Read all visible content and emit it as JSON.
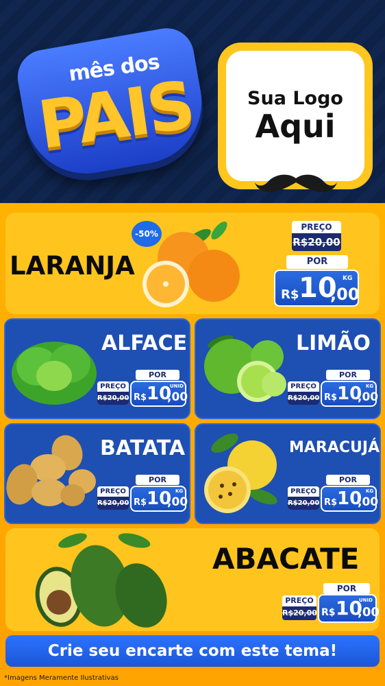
{
  "header": {
    "badge_sub": "mês dos",
    "badge_main": "PAIS",
    "logo_line1": "Sua Logo",
    "logo_line2": "Aqui"
  },
  "featured": {
    "name": "LARANJA",
    "discount": "-50%",
    "preco_label": "PREÇO",
    "old_price": "R$20,00",
    "por_label": "POR",
    "currency": "R$",
    "price_int": "10",
    "price_dec": ",00",
    "unit": "KG"
  },
  "products": [
    {
      "name": "ALFACE",
      "preco_label": "PREÇO",
      "old_price": "R$20,00",
      "por_label": "POR",
      "currency": "R$",
      "price_int": "10",
      "price_dec": ",00",
      "unit": "UNID"
    },
    {
      "name": "LIMÃO",
      "preco_label": "PREÇO",
      "old_price": "R$20,00",
      "por_label": "POR",
      "currency": "R$",
      "price_int": "10",
      "price_dec": ",00",
      "unit": "KG"
    },
    {
      "name": "BATATA",
      "preco_label": "PREÇO",
      "old_price": "R$20,00",
      "por_label": "POR",
      "currency": "R$",
      "price_int": "10",
      "price_dec": ",00",
      "unit": "KG"
    },
    {
      "name": "MARACUJÁ",
      "preco_label": "PREÇO",
      "old_price": "R$20,00",
      "por_label": "POR",
      "currency": "R$",
      "price_int": "10",
      "price_dec": ",00",
      "unit": "KG"
    }
  ],
  "bottom": {
    "name": "ABACATE",
    "preco_label": "PREÇO",
    "old_price": "R$20,00",
    "por_label": "POR",
    "currency": "R$",
    "price_int": "10",
    "price_dec": ",00",
    "unit": "UNID"
  },
  "cta": "Crie seu encarte com este tema!",
  "disclaimer": "*Imagens Meramente Ilustrativas",
  "colors": {
    "navy": "#0e2146",
    "yellow": "#ffc51e",
    "orange": "#ffa000",
    "blue": "#1e4fb2",
    "price_blue": "#1c2a72"
  }
}
